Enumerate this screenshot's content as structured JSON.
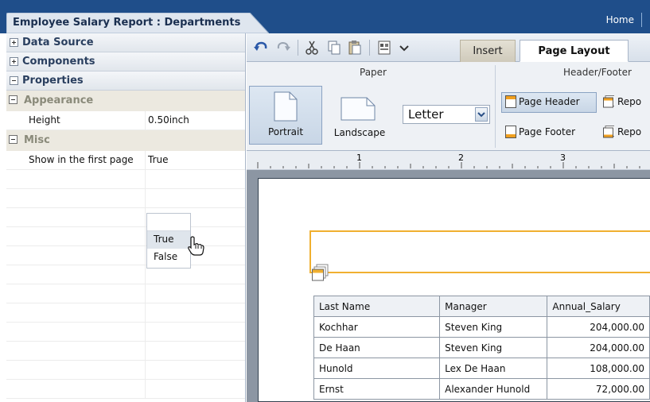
{
  "header": {
    "title": "Employee Salary Report : Departments",
    "home_link": "Home"
  },
  "left_panel": {
    "sections": [
      {
        "label": "Data Source",
        "expanded": false
      },
      {
        "label": "Components",
        "expanded": false
      },
      {
        "label": "Properties",
        "expanded": true
      }
    ],
    "groups": {
      "appearance": {
        "label": "Appearance",
        "rows": [
          {
            "key": "Height",
            "value": "0.50inch"
          }
        ]
      },
      "misc": {
        "label": "Misc",
        "rows": [
          {
            "key": "Show in the first page",
            "value": "True"
          }
        ]
      }
    },
    "dropdown": {
      "options": [
        "True",
        "False"
      ],
      "hovered": "True"
    }
  },
  "toolbar": {
    "icons": [
      "undo-icon",
      "redo-icon",
      "cut-icon",
      "copy-icon",
      "paste-icon",
      "view-icon",
      "chevron-down-icon"
    ],
    "tabs": [
      {
        "label": "Insert",
        "active": false
      },
      {
        "label": "Page Layout",
        "active": true
      }
    ]
  },
  "ribbon": {
    "paper": {
      "caption": "Paper",
      "portrait_label": "Portrait",
      "landscape_label": "Landscape",
      "size_value": "Letter"
    },
    "header_footer": {
      "caption": "Header/Footer",
      "page_header": "Page Header",
      "page_footer": "Page Footer",
      "report_header": "Repo",
      "report_footer": "Repo"
    }
  },
  "ruler": {
    "marks": [
      "1",
      "2",
      "3"
    ]
  },
  "report_table": {
    "columns": [
      "Last Name",
      "Manager",
      "Annual_Salary"
    ],
    "rows": [
      [
        "Kochhar",
        "Steven King",
        "204,000.00"
      ],
      [
        "De Haan",
        "Steven King",
        "204,000.00"
      ],
      [
        "Hunold",
        "Lex De Haan",
        "108,000.00"
      ],
      [
        "Ernst",
        "Alexander Hunold",
        "72,000.00"
      ]
    ]
  },
  "colors": {
    "top_bar": "#1f4e8a",
    "accent_border": "#f0b030",
    "canvas_bg": "#8c96a3"
  }
}
